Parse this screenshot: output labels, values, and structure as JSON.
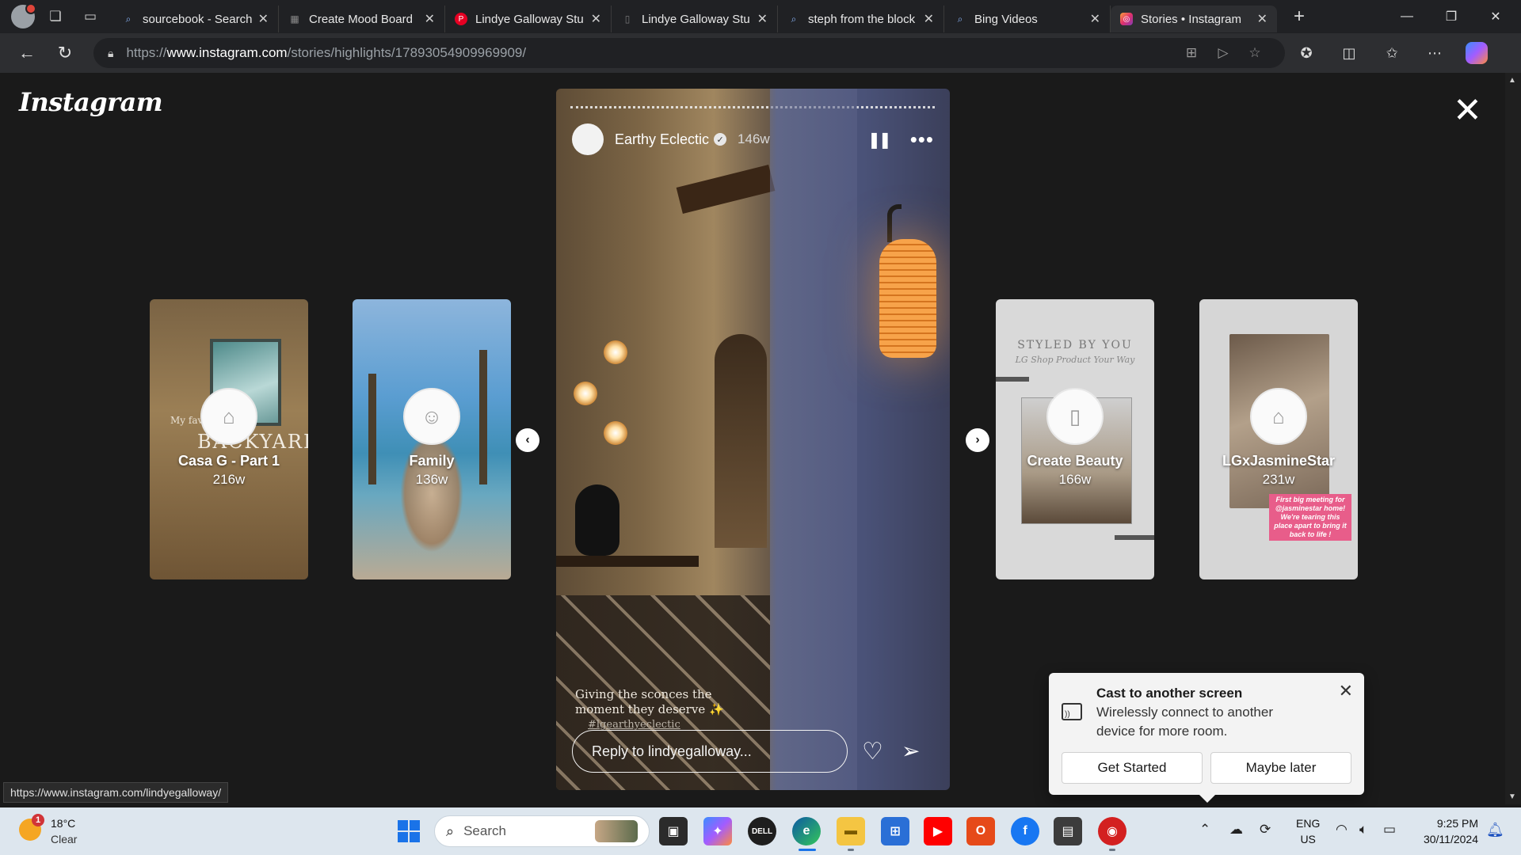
{
  "browser": {
    "tabs": [
      {
        "title": "sourcebook - Search",
        "icon": "search-icon"
      },
      {
        "title": "Create Mood Board",
        "icon": "moodboard-icon"
      },
      {
        "title": "Lindye Galloway Stu",
        "icon": "pinterest-icon"
      },
      {
        "title": "Lindye Galloway Stu",
        "icon": "page-icon"
      },
      {
        "title": "steph from the block",
        "icon": "search-icon"
      },
      {
        "title": "Bing Videos",
        "icon": "search-icon"
      },
      {
        "title": "Stories • Instagram",
        "icon": "instagram-icon",
        "active": true
      }
    ],
    "url_prefix": "https://",
    "url_host": "www.instagram.com",
    "url_path": "/stories/highlights/17893054909969909/",
    "status_url": "https://www.instagram.com/lindyegalloway/"
  },
  "instagram": {
    "logo": "Instagram",
    "story": {
      "username": "Earthy Eclectic",
      "age": "146w",
      "caption_line1": "Giving the sconces the",
      "caption_line2": "moment they deserve ✨",
      "hashtag": "#lgearthyeclectic",
      "reply_placeholder": "Reply to lindyegalloway..."
    },
    "highlights": [
      {
        "name": "Casa G - Part 1",
        "age": "216w",
        "overlay_a": "My fav",
        "overlay_b": "BACKYARD"
      },
      {
        "name": "Family",
        "age": "136w"
      },
      {
        "name": "Create Beauty",
        "age": "166w",
        "overlay_a": "STYLED BY YOU",
        "overlay_b": "LG Shop Product Your Way"
      },
      {
        "name": "LGxJasmineStar",
        "age": "231w",
        "overlay_a": "First big meeting for @jasminestar home! We're tearing this place apart to bring it back to life !"
      }
    ]
  },
  "toast": {
    "title": "Cast to another screen",
    "body": "Wirelessly connect to another device for more room.",
    "primary": "Get Started",
    "secondary": "Maybe later"
  },
  "taskbar": {
    "weather_temp": "18°C",
    "weather_cond": "Clear",
    "weather_alerts": "1",
    "search_label": "Search",
    "lang_line1": "ENG",
    "lang_line2": "US",
    "time": "9:25 PM",
    "date": "30/11/2024"
  }
}
